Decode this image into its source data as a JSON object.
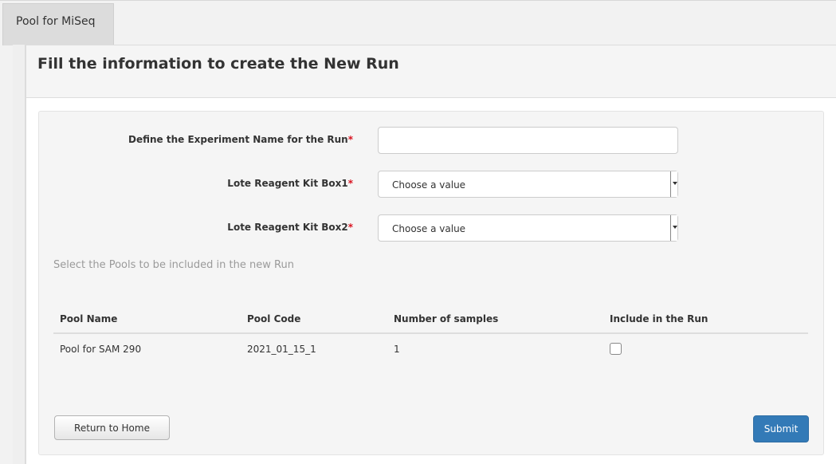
{
  "tabs": [
    {
      "label": "Pool for MiSeq"
    }
  ],
  "panel": {
    "title": "Fill the information to create the New Run"
  },
  "form": {
    "experiment_label": "Define the Experiment Name for the Run",
    "experiment_value": "",
    "box1_label": "Lote Reagent Kit Box1",
    "box1_value": "Choose a value",
    "box2_label": "Lote Reagent Kit Box2",
    "box2_value": "Choose a value",
    "required_marker": "*"
  },
  "pools": {
    "hint": "Select the Pools to be included in the new Run",
    "columns": [
      "Pool Name",
      "Pool Code",
      "Number of samples",
      "Include in the Run"
    ],
    "rows": [
      {
        "name": "Pool for SAM 290",
        "code": "2021_01_15_1",
        "samples": "1",
        "included": false
      }
    ]
  },
  "actions": {
    "home_label": "Return to Home",
    "submit_label": "Submit"
  },
  "colors": {
    "accent": "#337ab7",
    "required": "#d9121f"
  }
}
